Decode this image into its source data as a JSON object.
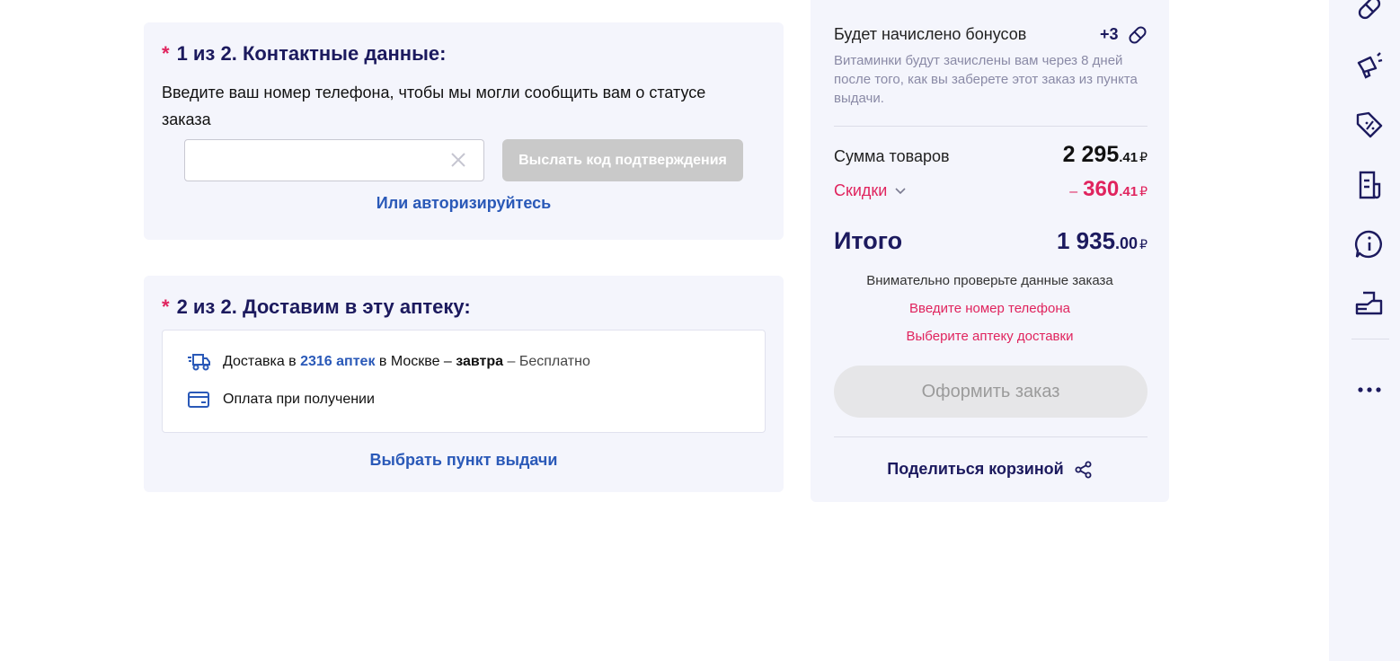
{
  "contact": {
    "step": "1 из 2. Контактные данные:",
    "required_mark": "*",
    "hint": "Введите ваш номер телефона, чтобы мы могли сообщить вам о статусе заказа",
    "phone_value": "",
    "send_code_label": "Выслать код подтверждения",
    "auth_link": "Или авторизируйтесь"
  },
  "delivery": {
    "step": "2 из 2. Доставим в эту аптеку:",
    "required_mark": "*",
    "delivery_prefix": "Доставка в ",
    "pharmacies_count": "2316 аптек",
    "delivery_mid": " в Москве – ",
    "delivery_when": "завтра",
    "delivery_price": " – Бесплатно",
    "payment": "Оплата при получении",
    "pickup_link": "Выбрать пункт выдачи"
  },
  "summary": {
    "bonus_title": "Будет начислено бонусов",
    "bonus_value": "+3",
    "bonus_note": "Витаминки будут зачислены вам через 8 дней после того, как вы заберете этот заказ из пункта выдачи.",
    "goods_label": "Сумма товаров",
    "goods_int": "2 295",
    "goods_cents": ".41",
    "currency": "₽",
    "discount_label": "Скидки",
    "discount_minus": "–",
    "discount_int": "360",
    "discount_cents": ".41",
    "total_label": "Итого",
    "total_int": "1 935",
    "total_cents": ".00",
    "check_note": "Внимательно проверьте данные заказа",
    "error_phone": "Введите номер телефона",
    "error_pharmacy": "Выберите аптеку доставки",
    "order_button": "Оформить заказ",
    "share_label": "Поделиться корзиной"
  },
  "icons": {
    "right_bar": [
      "pill-icon",
      "megaphone-icon",
      "discount-tag-icon",
      "receipt-icon",
      "info-chat-icon",
      "delivery-box-icon",
      "more-icon"
    ]
  },
  "colors": {
    "brand": "#1c1a5e",
    "link": "#2a59b8",
    "error": "#e0245e",
    "panel": "#f4f5fc"
  }
}
